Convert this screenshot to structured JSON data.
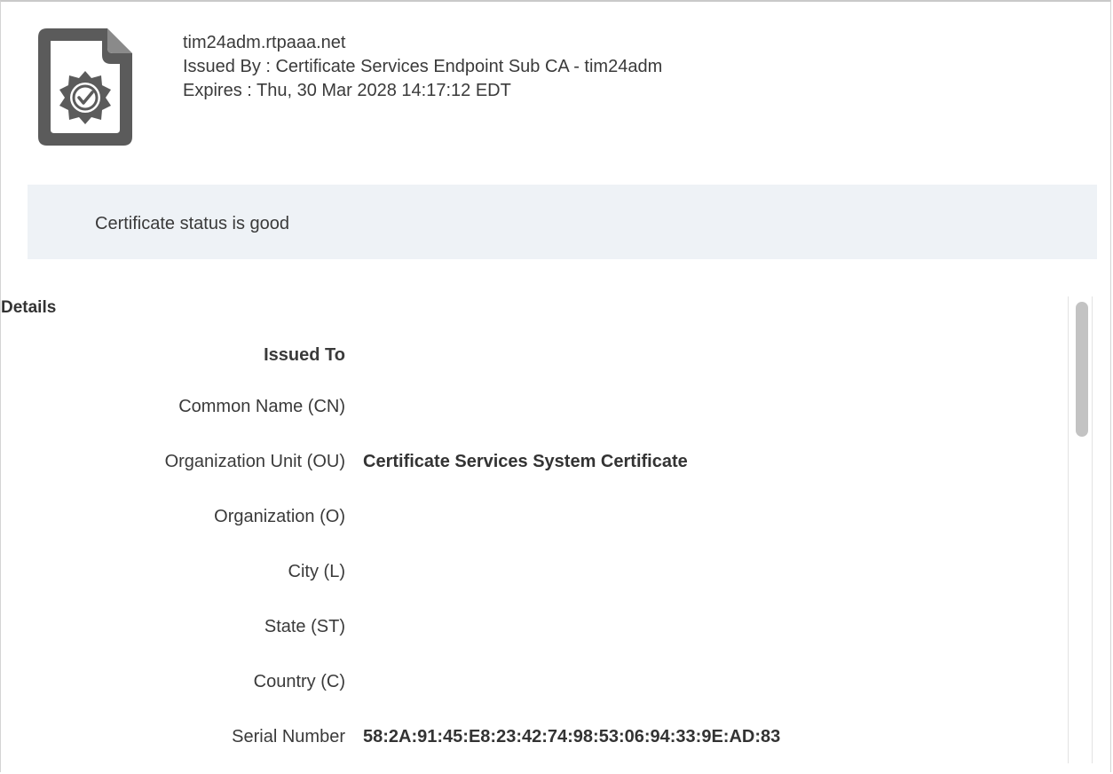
{
  "certificate": {
    "name": "tim24adm.rtpaaa.net",
    "issued_by": "Issued By : Certificate Services Endpoint Sub CA - tim24adm",
    "expires": "Expires : Thu, 30 Mar 2028 14:17:12 EDT",
    "icon": "certificate-badge-icon"
  },
  "status": {
    "text": "Certificate status is good"
  },
  "details": {
    "title": "Details",
    "section_heading": "Issued To",
    "rows": [
      {
        "label": "Common Name (CN)",
        "value": ""
      },
      {
        "label": "Organization Unit (OU)",
        "value": "Certificate Services System Certificate"
      },
      {
        "label": "Organization (O)",
        "value": ""
      },
      {
        "label": "City (L)",
        "value": ""
      },
      {
        "label": "State (ST)",
        "value": ""
      },
      {
        "label": "Country (C)",
        "value": ""
      },
      {
        "label": "Serial Number",
        "value": "58:2A:91:45:E8:23:42:74:98:53:06:94:33:9E:AD:83"
      }
    ]
  },
  "colors": {
    "status_bg": "#eef2f6",
    "icon": "#5b5b5b",
    "text": "#333333"
  }
}
